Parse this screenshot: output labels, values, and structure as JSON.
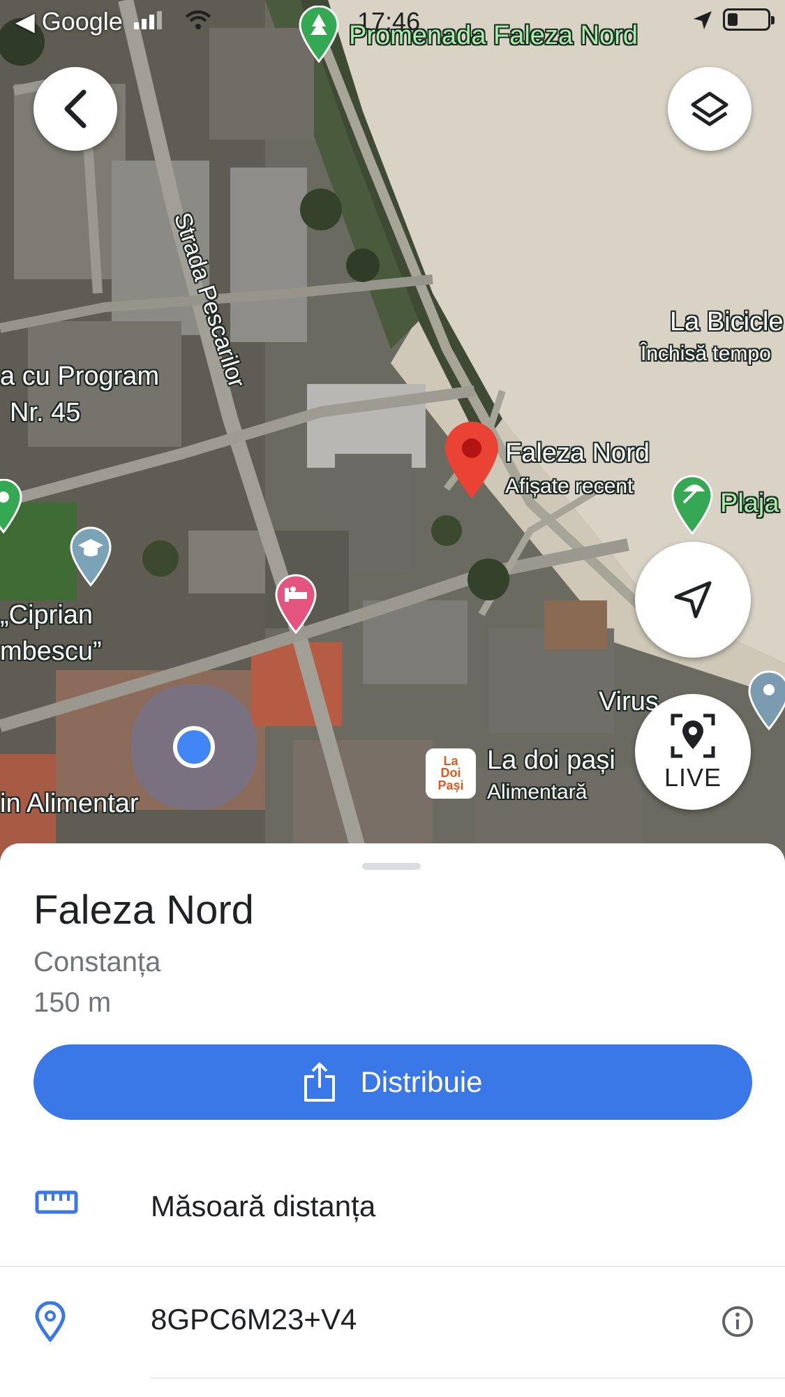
{
  "status_bar": {
    "back_app": "◀ Google",
    "time": "17:46"
  },
  "map": {
    "labels": {
      "promenade": "Promenada Faleza Nord",
      "street": "Strada Pescarilor",
      "bike_title": "La Bicicle",
      "bike_status": "Închisă tempo",
      "program_line1": "a cu Program",
      "program_line2": "Nr. 45",
      "selected_title": "Faleza Nord",
      "selected_sub": "Afișate recent",
      "beach": "Plaja",
      "school_line1": "„Ciprian",
      "school_line2": "mbescu”",
      "virus": "Virus",
      "store_title": "La doi pași",
      "store_sub": "Alimentară",
      "alimentar": "in Alimentar"
    },
    "store_logo": [
      "La",
      "Doi",
      "Pași"
    ],
    "live_label": "LIVE",
    "icons": {
      "back": "chevron-left-icon",
      "layers": "layers-icon",
      "navigate": "navigation-arrow-icon",
      "live": "live-view-icon"
    }
  },
  "sheet": {
    "title": "Faleza Nord",
    "city": "Constanța",
    "distance": "150 m",
    "share_label": "Distribuie",
    "measure_label": "Măsoară distanța",
    "plus_code": "8GPC6M23+V4"
  },
  "colors": {
    "accent_blue": "#3b78e7",
    "pin_red": "#ea4335",
    "user_dot": "#4285f4",
    "hotel_pink": "#e3557f",
    "park_green": "#34a853"
  }
}
